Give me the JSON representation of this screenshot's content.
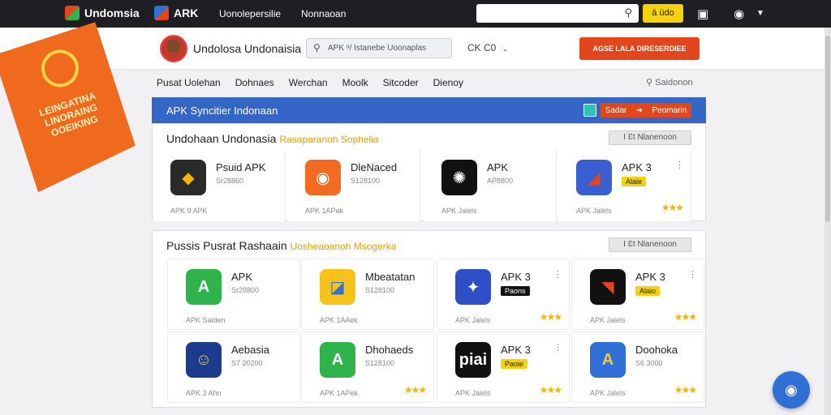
{
  "topbar": {
    "brand1": "Undomsia",
    "brand2": "ARK",
    "link1": "Uonolepersilie",
    "link2": "Nonnaoan",
    "search_placeholder": "",
    "search_btn": "ā ūdo"
  },
  "header": {
    "site_title": "Undolosa Undonaisia",
    "search_text": "APK  ᵒ/ Istanebe Uoonaplas",
    "lang": "CK  C0",
    "cta": "AGSE LALA DIRESERDIEE"
  },
  "nav": {
    "items": [
      "Pusat Uolehan",
      "Dohnaes",
      "Werchan",
      "Moolk",
      "Sitcoder",
      "Dienoy"
    ],
    "right": "Saidonon"
  },
  "flag": {
    "text": "LEINGATINA LINORAING OOEIKING"
  },
  "panel": {
    "title": "APK  Syncitier Indonaan",
    "btn_left": "Sadar",
    "btn_right": "Peomarin"
  },
  "section1": {
    "title": "Undohaan Undonasia",
    "subtitle": "Rasaparanoh Sophelia",
    "chip": "Ⅰ Ɛt Nlanenoon",
    "cards": [
      {
        "name": "Psuid APK",
        "meta": "Sr28860",
        "foot": "APK 9 APK",
        "icon_color": "#2a2a2a",
        "icon_glyph": "◆",
        "icon_text_color": "#f4b400"
      },
      {
        "name": "DleNaced",
        "meta": "S128100",
        "foot": "APK 1APak",
        "icon_color": "#f36b21",
        "icon_glyph": "◉",
        "icon_text_color": "#fff"
      },
      {
        "name": "APK",
        "meta": "AP8800",
        "foot": "APK Jalels",
        "icon_color": "#111111",
        "icon_glyph": "✺",
        "icon_text_color": "#fff"
      },
      {
        "name": "APK 3",
        "tag": "Alaie",
        "foot": "APK Jalels",
        "icon_color": "#3a5fd0",
        "icon_glyph": "◢",
        "icon_text_color": "#e3461b"
      }
    ]
  },
  "section2": {
    "title": "Pussis Pusrat Rashaain",
    "subtitle": "Uosheaoanoh Msogerka",
    "chip": "Ⅰ Ɛt Nlanenoon",
    "cards": [
      {
        "name": "APK",
        "meta": "Sr28800",
        "foot": "APK Saiden",
        "icon_color": "#2fb34b",
        "icon_glyph": "A",
        "icon_text_color": "#fff"
      },
      {
        "name": "Mbeatatan",
        "meta": "S128100",
        "foot": "APK 1AAek",
        "icon_color": "#f7c31b",
        "icon_glyph": "◪",
        "icon_text_color": "#2f6fd6"
      },
      {
        "name": "APK 3",
        "tag": "Paons",
        "foot": "APK Jalels",
        "icon_color": "#2f4fc9",
        "icon_glyph": "✦",
        "icon_text_color": "#fff"
      },
      {
        "name": "APK 3",
        "tag": "Alaio",
        "foot": "APK Jalels",
        "icon_color": "#111111",
        "icon_glyph": "◥",
        "icon_text_color": "#e3461b"
      },
      {
        "name": "Aebasia",
        "meta": "S7 20200",
        "foot": "APK 3 Ahn",
        "icon_color": "#1b3b8c",
        "icon_glyph": "☺",
        "icon_text_color": "#f4c542"
      },
      {
        "name": "Dhohaeds",
        "meta": "S128100",
        "foot": "APK 1APek",
        "icon_color": "#2fb34b",
        "icon_glyph": "A",
        "icon_text_color": "#fff"
      },
      {
        "name": "APK 3",
        "tag": "Paoie",
        "foot": "APK Jalels",
        "icon_color": "#111111",
        "icon_glyph": "piai",
        "icon_text_color": "#fff"
      },
      {
        "name": "Doohoka",
        "meta": "S6 3000",
        "foot": "APK Jalels",
        "icon_color": "#2f6fd6",
        "icon_glyph": "A",
        "icon_text_color": "#f4c542"
      }
    ]
  },
  "colors": {
    "accent": "#e3461b",
    "panel_blue": "#3366c6",
    "star": "#f4b400"
  }
}
